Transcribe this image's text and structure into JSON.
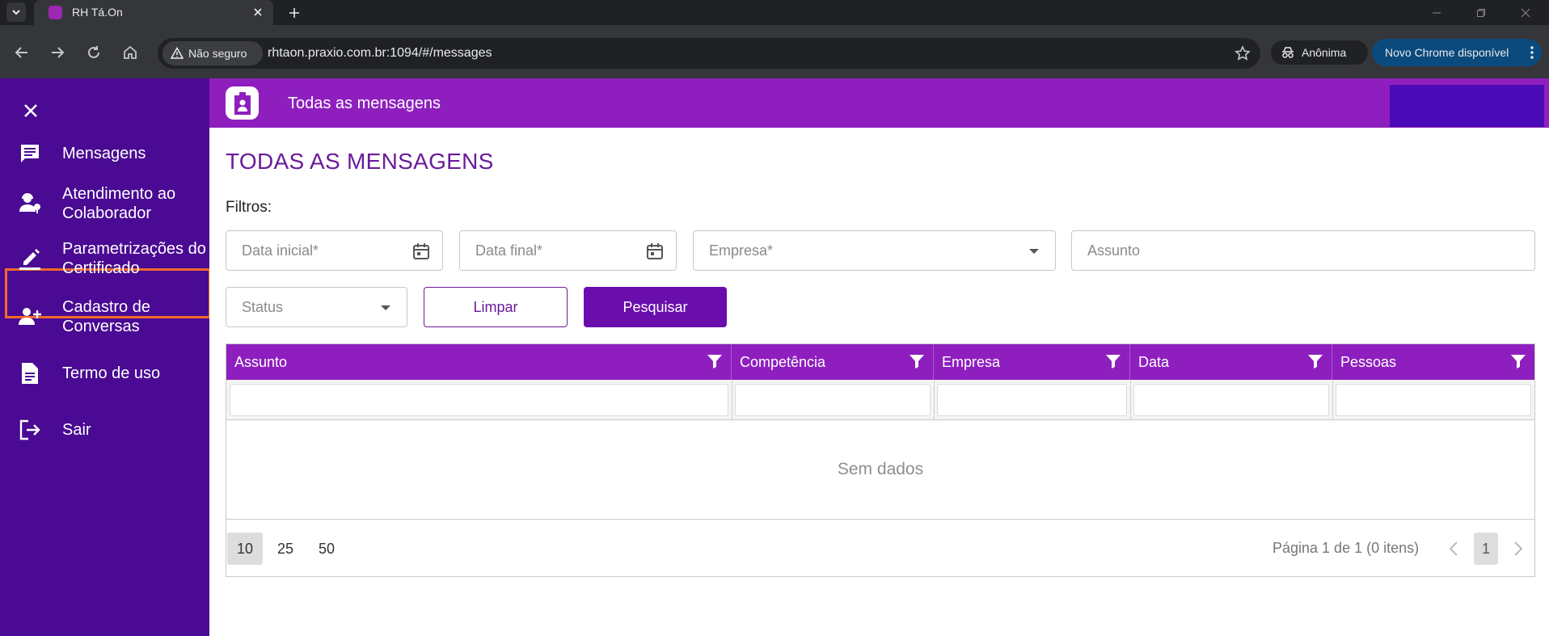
{
  "browser": {
    "tab_title": "RH Tá.On",
    "security_label": "Não seguro",
    "url": "rhtaon.praxio.com.br:1094/#/messages",
    "incognito_label": "Anônima",
    "update_label": "Novo Chrome disponível"
  },
  "sidebar": {
    "items": [
      {
        "label": "Mensagens",
        "icon": "message-icon"
      },
      {
        "label": "Atendimento ao Colaborador",
        "icon": "support-agent-icon"
      },
      {
        "label": "Parametrizações do Certificado",
        "icon": "edit-pen-icon"
      },
      {
        "label": "Cadastro de Conversas",
        "icon": "add-person-icon"
      },
      {
        "label": "Termo de uso",
        "icon": "document-icon"
      },
      {
        "label": "Sair",
        "icon": "logout-icon"
      }
    ]
  },
  "appbar": {
    "title": "Todas as mensagens"
  },
  "main": {
    "heading": "TODAS AS MENSAGENS",
    "filters_label": "Filtros:",
    "filters": {
      "start_date_placeholder": "Data inicial*",
      "end_date_placeholder": "Data final*",
      "company_placeholder": "Empresa*",
      "subject_placeholder": "Assunto",
      "status_placeholder": "Status"
    },
    "buttons": {
      "clear": "Limpar",
      "search": "Pesquisar"
    },
    "grid": {
      "columns": [
        "Assunto",
        "Competência",
        "Empresa",
        "Data",
        "Pessoas"
      ],
      "no_data": "Sem dados",
      "page_sizes": [
        "10",
        "25",
        "50"
      ],
      "page_info": "Página 1 de 1 (0 itens)",
      "current_page": "1"
    }
  },
  "colors": {
    "sidebar_bg": "#4a0a93",
    "appbar_bg": "#8e1fbe",
    "accent": "#6a0dad",
    "highlight": "#f06a2a"
  }
}
